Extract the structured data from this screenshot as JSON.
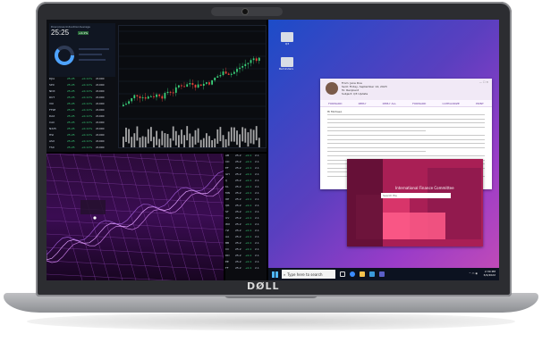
{
  "brand": {
    "logo": "DØLL"
  },
  "trading": {
    "title": "Dow Jones Industrial Average",
    "price": "25:25",
    "badge": "+1.1%",
    "rows": [
      [
        "DJIA",
        "25.25",
        "+0.11%",
        "21000"
      ],
      [
        "SPX",
        "25.25",
        "+0.11%",
        "21000"
      ],
      [
        "NDX",
        "25.25",
        "+0.11%",
        "21000"
      ],
      [
        "RUT",
        "25.25",
        "+0.11%",
        "21000"
      ],
      [
        "VIX",
        "25.25",
        "+0.11%",
        "21000"
      ],
      [
        "FTSE",
        "25.25",
        "+0.11%",
        "21000"
      ],
      [
        "DAX",
        "25.25",
        "+0.11%",
        "21000"
      ],
      [
        "CAC",
        "25.25",
        "+0.11%",
        "21000"
      ],
      [
        "N225",
        "25.25",
        "+0.11%",
        "21000"
      ],
      [
        "HSI",
        "25.25",
        "+0.11%",
        "21000"
      ],
      [
        "ASX",
        "25.25",
        "+0.11%",
        "21000"
      ],
      [
        "TSX",
        "25.25",
        "+0.11%",
        "21000"
      ]
    ]
  },
  "side_table": {
    "rows": [
      [
        "AB",
        "25.2",
        "+0.1",
        "2.1"
      ],
      [
        "CD",
        "25.2",
        "+0.1",
        "2.1"
      ],
      [
        "EF",
        "25.2",
        "+0.1",
        "2.1"
      ],
      [
        "GH",
        "25.2",
        "+0.1",
        "2.1"
      ],
      [
        "IJ",
        "25.2",
        "+0.1",
        "2.1"
      ],
      [
        "KL",
        "25.2",
        "+0.1",
        "2.1"
      ],
      [
        "MN",
        "25.2",
        "+0.1",
        "2.1"
      ],
      [
        "OP",
        "25.2",
        "+0.1",
        "2.1"
      ],
      [
        "QR",
        "25.2",
        "+0.1",
        "2.1"
      ],
      [
        "ST",
        "25.2",
        "+0.1",
        "2.1"
      ],
      [
        "UV",
        "25.2",
        "+0.1",
        "2.1"
      ],
      [
        "WX",
        "25.2",
        "+0.1",
        "2.1"
      ],
      [
        "YZ",
        "25.2",
        "+0.1",
        "2.1"
      ],
      [
        "AA",
        "25.2",
        "+0.1",
        "2.1"
      ],
      [
        "BB",
        "25.2",
        "+0.1",
        "2.1"
      ],
      [
        "CC",
        "25.2",
        "+0.1",
        "2.1"
      ],
      [
        "DD",
        "25.2",
        "+0.1",
        "2.1"
      ],
      [
        "EE",
        "25.2",
        "+0.1",
        "2.1"
      ],
      [
        "FF",
        "25.2",
        "+0.1",
        "2.1"
      ]
    ]
  },
  "desktop": {
    "icons": [
      {
        "label": "Q3"
      },
      {
        "label": "Reminders"
      }
    ]
  },
  "mail": {
    "from": "From: Jane Doe",
    "date": "Sent: Friday, September 14, 2023",
    "to": "To: Recipient",
    "subject": "Subject: Q3 Update",
    "tabs": [
      "FORWARD",
      "REPLY",
      "REPLY ALL",
      "FORWARD",
      "CATEGORIZE",
      "PRINT"
    ],
    "greeting": "Hi Michael,"
  },
  "finance_window": {
    "title": "International Finance Committee",
    "search_placeholder": "Search file"
  },
  "taskbar": {
    "search_placeholder": "Type here to search",
    "time": "2:30 PM",
    "date": "3/4/2022"
  },
  "colors": {
    "up": "#3ad07a",
    "down": "#e8443a",
    "desktop_accent": "#5a3fbf"
  }
}
